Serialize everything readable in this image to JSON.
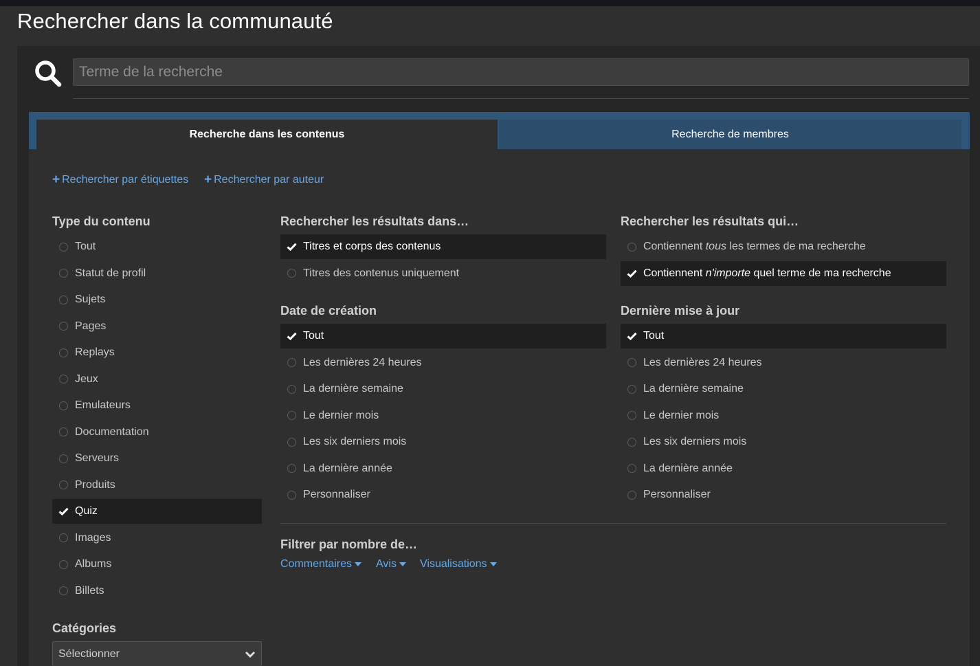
{
  "page": {
    "title": "Rechercher dans la communauté"
  },
  "search": {
    "placeholder": "Terme de la recherche",
    "value": ""
  },
  "tabs": [
    {
      "label": "Recherche dans les contenus",
      "active": true
    },
    {
      "label": "Recherche de membres",
      "active": false
    }
  ],
  "links": {
    "by_tags": "Rechercher par étiquettes",
    "by_author": "Rechercher par auteur"
  },
  "content_type": {
    "heading": "Type du contenu",
    "items": [
      {
        "label": "Tout",
        "checked": false
      },
      {
        "label": "Statut de profil",
        "checked": false
      },
      {
        "label": "Sujets",
        "checked": false
      },
      {
        "label": "Pages",
        "checked": false
      },
      {
        "label": "Replays",
        "checked": false
      },
      {
        "label": "Jeux",
        "checked": false
      },
      {
        "label": "Emulateurs",
        "checked": false
      },
      {
        "label": "Documentation",
        "checked": false
      },
      {
        "label": "Serveurs",
        "checked": false
      },
      {
        "label": "Produits",
        "checked": false
      },
      {
        "label": "Quiz",
        "checked": true
      },
      {
        "label": "Images",
        "checked": false
      },
      {
        "label": "Albums",
        "checked": false
      },
      {
        "label": "Billets",
        "checked": false
      }
    ]
  },
  "search_in": {
    "heading": "Rechercher les résultats dans…",
    "items": [
      {
        "label": "Titres et corps des contenus",
        "checked": true
      },
      {
        "label": "Titres des contenus uniquement",
        "checked": false
      }
    ]
  },
  "search_which": {
    "heading": "Rechercher les résultats qui…",
    "items": [
      {
        "pre": "Contiennent ",
        "em": "tous",
        "post": " les termes de ma recherche",
        "checked": false
      },
      {
        "pre": "Contiennent ",
        "em": "n'importe",
        "post": " quel terme de ma recherche",
        "checked": true
      }
    ]
  },
  "created": {
    "heading": "Date de création",
    "items": [
      {
        "label": "Tout",
        "checked": true
      },
      {
        "label": "Les dernières 24 heures",
        "checked": false
      },
      {
        "label": "La dernière semaine",
        "checked": false
      },
      {
        "label": "Le dernier mois",
        "checked": false
      },
      {
        "label": "Les six derniers mois",
        "checked": false
      },
      {
        "label": "La dernière année",
        "checked": false
      },
      {
        "label": "Personnaliser",
        "checked": false
      }
    ]
  },
  "updated": {
    "heading": "Dernière mise à jour",
    "items": [
      {
        "label": "Tout",
        "checked": true
      },
      {
        "label": "Les dernières 24 heures",
        "checked": false
      },
      {
        "label": "La dernière semaine",
        "checked": false
      },
      {
        "label": "Le dernier mois",
        "checked": false
      },
      {
        "label": "Les six derniers mois",
        "checked": false
      },
      {
        "label": "La dernière année",
        "checked": false
      },
      {
        "label": "Personnaliser",
        "checked": false
      }
    ]
  },
  "filter": {
    "heading": "Filtrer par nombre de…",
    "items": [
      "Commentaires",
      "Avis",
      "Visualisations"
    ]
  },
  "categories": {
    "heading": "Catégories",
    "selected": "Sélectionner"
  },
  "colors": {
    "accent_link": "#66a8e8",
    "tab_bar": "#2f5579",
    "checked_row": "#1f1f1f",
    "background": "#2f2f2f"
  },
  "icons": {
    "search": "search-icon",
    "plus": "plus-icon",
    "check": "check-icon",
    "radio": "radio-empty-icon",
    "caret": "caret-down-icon",
    "select_chevron": "chevron-down-icon"
  }
}
